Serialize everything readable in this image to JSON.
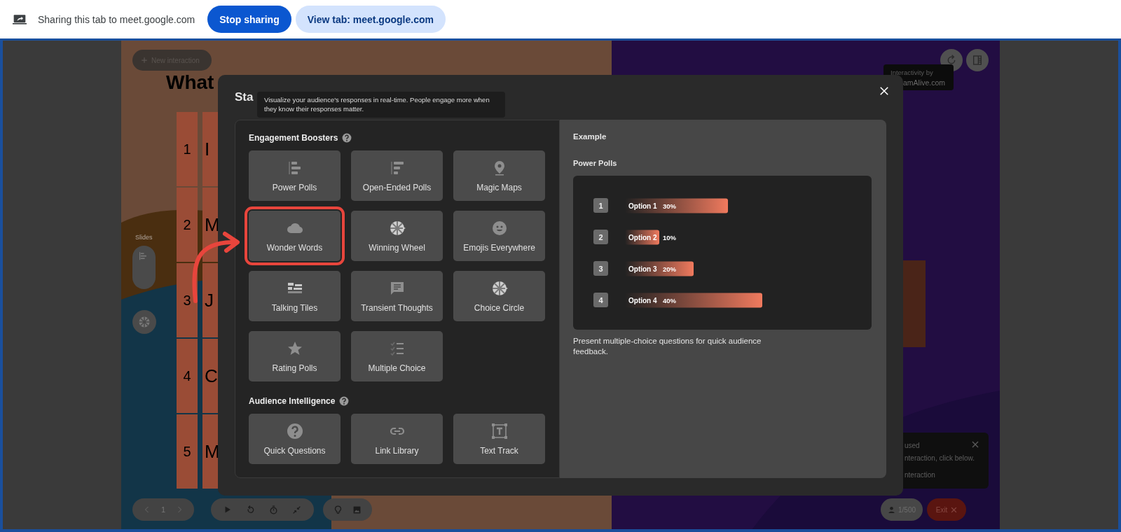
{
  "share_bar": {
    "message": "Sharing this tab to meet.google.com",
    "buttons": [
      {
        "label": "Stop sharing",
        "kind": "primary"
      },
      {
        "label": "View tab: meet.google.com",
        "kind": "secondary"
      }
    ]
  },
  "slide": {
    "new_interaction": "New interaction",
    "question": "What",
    "options": [
      {
        "number": "1",
        "text": "I"
      },
      {
        "number": "2",
        "text": "M"
      },
      {
        "number": "3",
        "text": "J"
      },
      {
        "number": "4",
        "text": "C"
      },
      {
        "number": "5",
        "text": "M"
      }
    ],
    "slides_label": "Slides",
    "badge": [
      "Interactivity by",
      "amAlive.com"
    ],
    "notification": [
      "used",
      "nteraction, click below.",
      "nteraction"
    ],
    "page": "1",
    "participants": "1/500",
    "exit": "Exit"
  },
  "modal": {
    "title": "Sta",
    "tooltip": "Visualize your audience's responses in real-time. People engage more when they know their responses matter.",
    "sections": [
      {
        "title": "Engagement Boosters",
        "tiles": [
          {
            "label": "Power Polls",
            "highlighted": false
          },
          {
            "label": "Open-Ended Polls",
            "highlighted": false
          },
          {
            "label": "Magic Maps",
            "highlighted": false
          },
          {
            "label": "Wonder Words",
            "highlighted": true
          },
          {
            "label": "Winning Wheel",
            "highlighted": false
          },
          {
            "label": "Emojis Everywhere",
            "highlighted": false
          },
          {
            "label": "Talking Tiles",
            "highlighted": false
          },
          {
            "label": "Transient Thoughts",
            "highlighted": false
          },
          {
            "label": "Choice Circle",
            "highlighted": false
          },
          {
            "label": "Rating Polls",
            "highlighted": false
          },
          {
            "label": "Multiple Choice",
            "highlighted": false
          }
        ]
      },
      {
        "title": "Audience Intelligence",
        "tiles": [
          {
            "label": "Quick Questions",
            "highlighted": false
          },
          {
            "label": "Link Library",
            "highlighted": false
          },
          {
            "label": "Text Track",
            "highlighted": false
          }
        ]
      }
    ],
    "example": {
      "heading": "Example",
      "title": "Power Polls",
      "option_numbers": [
        "1",
        "2",
        "3",
        "4"
      ],
      "chart_data": {
        "type": "bar",
        "orientation": "horizontal",
        "categories": [
          "Option 1",
          "Option 2",
          "Option 3",
          "Option 4"
        ],
        "values": [
          30,
          10,
          20,
          40
        ],
        "value_labels": [
          "30%",
          "10%",
          "20%",
          "40%"
        ]
      },
      "description": "Present multiple-choice questions for quick audience feedback."
    }
  }
}
